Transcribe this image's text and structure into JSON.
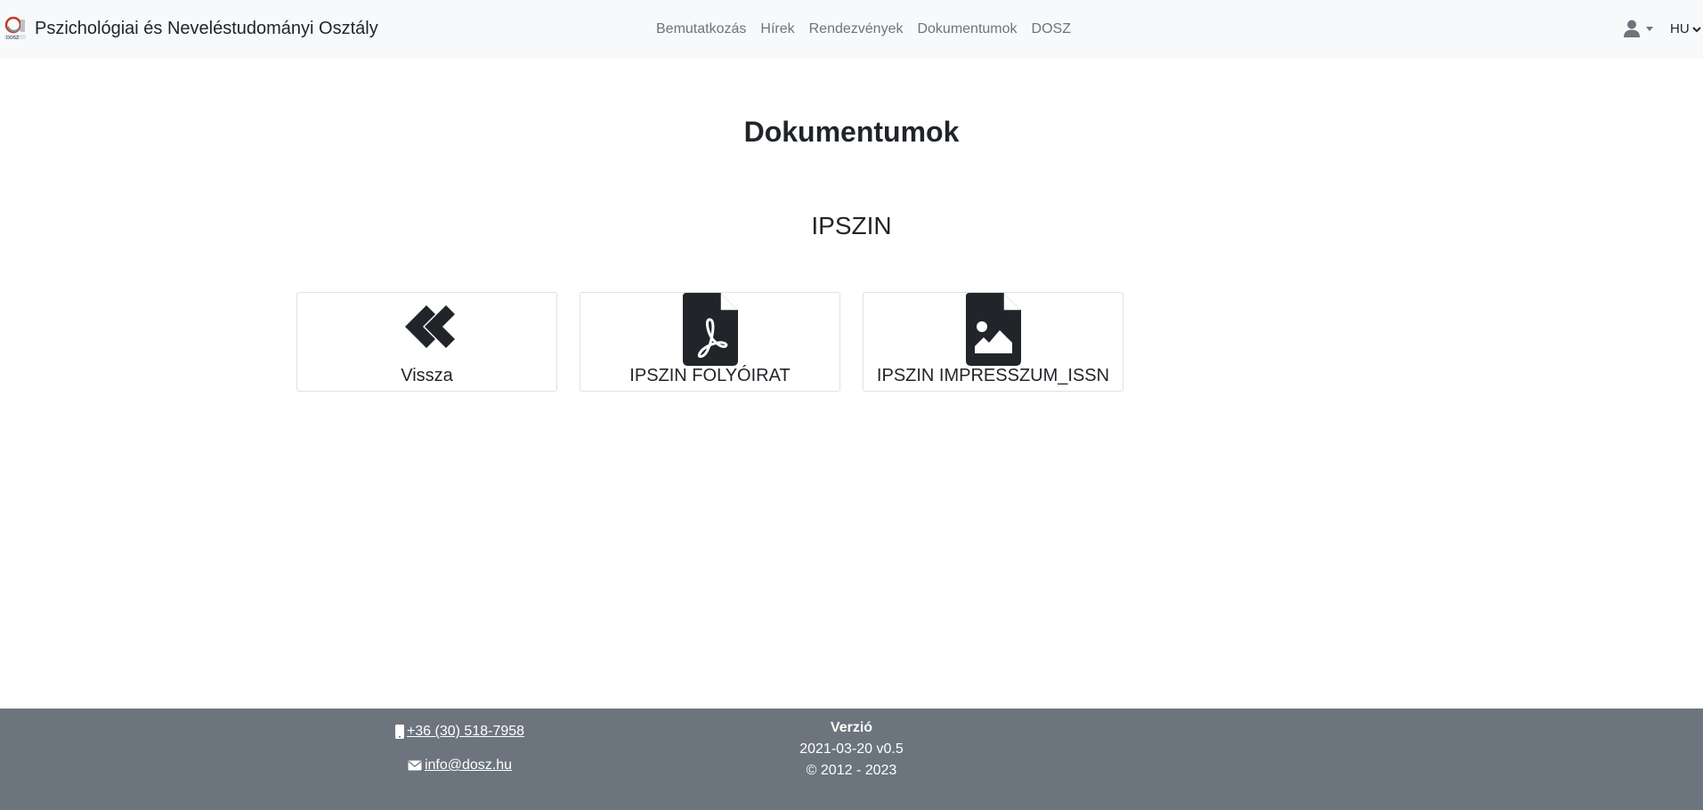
{
  "navbar": {
    "brand": "Pszichológiai és Neveléstudományi Osztály",
    "links": [
      "Bemutatkozás",
      "Hírek",
      "Rendezvények",
      "Dokumentumok",
      "DOSZ"
    ],
    "language": "HU"
  },
  "main": {
    "title": "Dokumentumok",
    "section": "IPSZIN",
    "cards": [
      {
        "label": "Vissza",
        "icon": "angles-left-icon"
      },
      {
        "label": "IPSZIN FOLYÓIRAT",
        "icon": "file-pdf-icon"
      },
      {
        "label": "IPSZIN IMPRESSZUM_ISSN",
        "icon": "file-image-icon"
      }
    ]
  },
  "footer": {
    "phone": " +36 (30) 518-7958",
    "email": " info@dosz.hu",
    "version_title": "Verzió",
    "version": "2021-03-20 v0.5",
    "copyright": "© 2012 - 2023"
  },
  "colors": {
    "navbar_bg": "#f8f9fa",
    "footer_bg": "#6c757d",
    "icon": "#212529",
    "nav_link": "#6c757d"
  }
}
